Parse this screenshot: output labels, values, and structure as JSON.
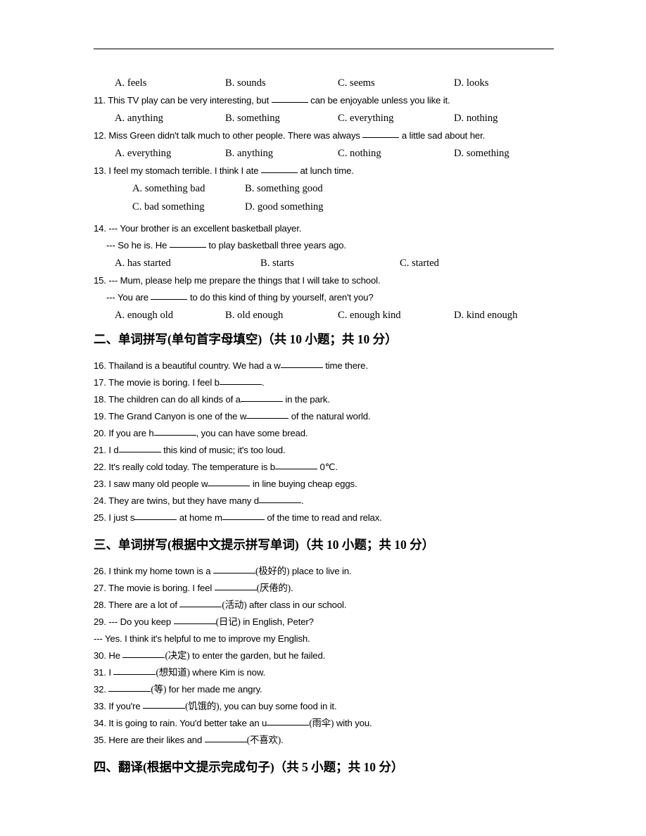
{
  "document": {
    "type": "english-exam-worksheet",
    "header_rule": true
  },
  "top_options": {
    "a": "A. feels",
    "b": "B. sounds",
    "c": "C. seems",
    "d": "D. looks"
  },
  "multiple_choice": [
    {
      "number": "11.",
      "stem_pre": "This TV play can be very interesting, but",
      "stem_post": "can be enjoyable unless you like it.",
      "options": [
        "A. anything",
        "B. something",
        "C. everything",
        "D. nothing"
      ],
      "layout": "4col"
    },
    {
      "number": "12.",
      "stem_pre": "Miss Green didn't talk much to other people. There was always",
      "stem_post": "a little sad about her.",
      "options": [
        "A. everything",
        "B. anything",
        "C. nothing",
        "D. something"
      ],
      "layout": "4col"
    },
    {
      "number": "13.",
      "stem_pre": "I feel my stomach terrible. I think I ate",
      "stem_post": "at lunch time.",
      "options": [
        "A. something bad",
        "B. something good",
        "C. bad something",
        "D. good something"
      ],
      "layout": "2col"
    },
    {
      "number": "14.",
      "dialogue_1": "--- Your brother is an excellent basketball player.",
      "dialogue_2_pre": "--- So he is. He",
      "dialogue_2_post": "to play basketball three years ago.",
      "options": [
        "A. has started",
        "B. starts",
        "C. started"
      ],
      "layout": "3col"
    },
    {
      "number": "15.",
      "dialogue_1": "--- Mum, please help me prepare the things that I will take to school.",
      "dialogue_2_pre": "--- You are",
      "dialogue_2_post": "to do this kind of thing by yourself, aren't you?",
      "options": [
        "A. enough old",
        "B. old enough",
        "C. enough kind",
        "D. kind enough"
      ],
      "layout": "4col"
    }
  ],
  "section_two": {
    "heading": "二、单词拼写(单句首字母填空)（共 10 小题；共 10 分）",
    "items": [
      {
        "number": "16.",
        "pre": "Thailand is a beautiful country. We had a w",
        "post": "time there."
      },
      {
        "number": "17.",
        "pre": "The movie is boring. I feel b",
        "post": "."
      },
      {
        "number": "18.",
        "pre": "The children can do all kinds of a",
        "post": "in the park."
      },
      {
        "number": "19.",
        "pre": "The Grand Canyon is one of the w",
        "post": "of the natural world."
      },
      {
        "number": "20.",
        "pre": "If you are h",
        "post": ", you can have some bread."
      },
      {
        "number": "21.",
        "pre": "I d",
        "post": "this kind of music; it's too loud."
      },
      {
        "number": "22.",
        "pre": "It's really cold today. The temperature is b",
        "post": "0℃."
      },
      {
        "number": "23.",
        "pre": "I saw many old people w",
        "post": "in line buying cheap eggs."
      },
      {
        "number": "24.",
        "pre": "They are twins, but they have many d",
        "post": "."
      },
      {
        "number": "25.",
        "pre": "I just s",
        "mid": "at home m",
        "post": "of the time to read and relax."
      }
    ]
  },
  "section_three": {
    "heading": "三、单词拼写(根据中文提示拼写单词)（共 10 小题；共 10 分）",
    "items": [
      {
        "number": "26.",
        "pre": "I think my home town is a",
        "hint": "(极好的)",
        "post": "place to live in."
      },
      {
        "number": "27.",
        "pre": "The movie is boring. I feel",
        "hint": "(厌倦的)",
        "post": "."
      },
      {
        "number": "28.",
        "pre": "There are a lot of",
        "hint": "(活动)",
        "post": "after class in our school."
      },
      {
        "number": "29.",
        "pre": "--- Do you keep",
        "hint": "(日记)",
        "post": "in English, Peter?"
      },
      {
        "number": "",
        "plain": "--- Yes. I think it's helpful to me to improve my English."
      },
      {
        "number": "30.",
        "pre": "He",
        "hint": "(决定)",
        "post": "to enter the garden, but he failed."
      },
      {
        "number": "31.",
        "pre": "I",
        "hint": "(想知道)",
        "post": "where Kim is now."
      },
      {
        "number": "32.",
        "pre": "",
        "hint": "(等)",
        "post": "for her made me angry."
      },
      {
        "number": "33.",
        "pre": "If you're",
        "hint": "(饥饿的)",
        "post": ", you can buy some food in it."
      },
      {
        "number": "34.",
        "pre": "It is going to rain. You'd better take an u",
        "hint": "(雨伞)",
        "post": "with you."
      },
      {
        "number": "35.",
        "pre": "Here are their likes and",
        "hint": "(不喜欢)",
        "post": "."
      }
    ]
  },
  "section_four": {
    "heading": "四、翻译(根据中文提示完成句子)（共 5 小题；共 10 分）"
  }
}
